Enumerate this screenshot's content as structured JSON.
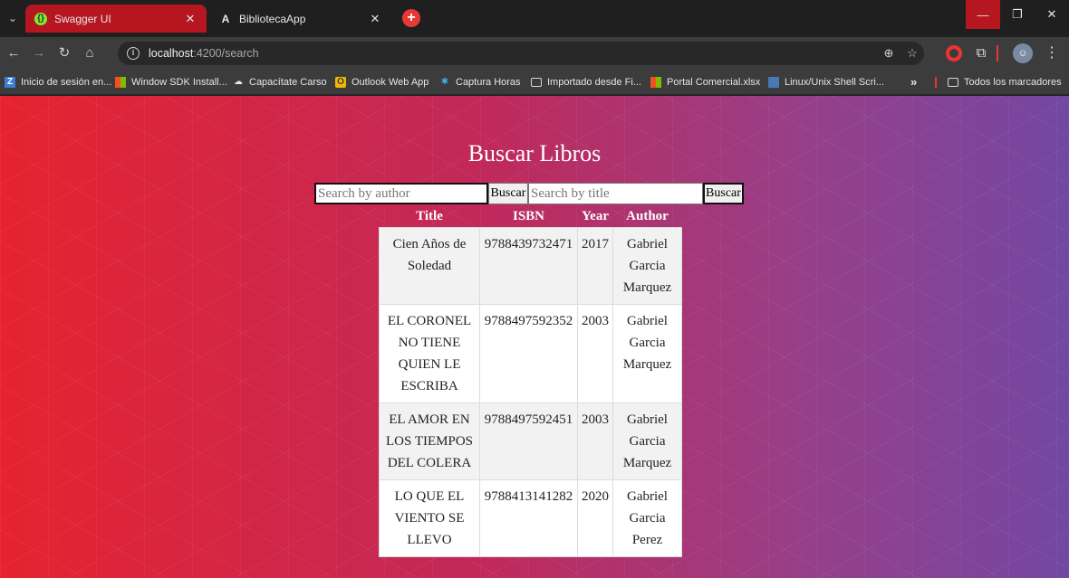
{
  "browser": {
    "tabs": [
      {
        "title": "Swagger UI",
        "active": true
      },
      {
        "title": "BibliotecaApp",
        "active": false
      }
    ],
    "url_host": "localhost",
    "url_path": ":4200/search",
    "bookmarks": [
      {
        "label": "Inicio de sesión en...",
        "icon": "z-icon"
      },
      {
        "label": "Window SDK Install...",
        "icon": "windows-icon"
      },
      {
        "label": "Capacítate Carso",
        "icon": "cloud-icon"
      },
      {
        "label": "Outlook Web App",
        "icon": "outlook-icon"
      },
      {
        "label": "Captura Horas",
        "icon": "spinner-icon"
      },
      {
        "label": "Importado desde Fi...",
        "icon": "folder-icon"
      },
      {
        "label": "Portal Comercial.xlsx",
        "icon": "windows-icon"
      },
      {
        "label": "Linux/Unix Shell Scri...",
        "icon": "linux-icon"
      }
    ],
    "bookmarks_overflow": "»",
    "all_bookmarks": "Todos los marcadores"
  },
  "page": {
    "title": "Buscar Libros",
    "author_search_placeholder": "Search by author",
    "author_search_button": "Buscar",
    "title_search_placeholder": "Search by title",
    "title_search_button": "Buscar",
    "table": {
      "headers": [
        "Title",
        "ISBN",
        "Year",
        "Author"
      ],
      "rows": [
        {
          "title": "Cien Años de Soledad",
          "isbn": "9788439732471",
          "year": "2017",
          "author": "Gabriel Garcia Marquez"
        },
        {
          "title": "EL CORONEL NO TIENE QUIEN LE ESCRIBA",
          "isbn": "9788497592352",
          "year": "2003",
          "author": "Gabriel Garcia Marquez"
        },
        {
          "title": "EL AMOR EN LOS TIEMPOS DEL COLERA",
          "isbn": "9788497592451",
          "year": "2003",
          "author": "Gabriel Garcia Marquez"
        },
        {
          "title": "LO QUE EL VIENTO SE LLEVO",
          "isbn": "9788413141282",
          "year": "2020",
          "author": "Gabriel Garcia Perez"
        }
      ]
    }
  },
  "colors": {
    "gradient_start": "#e6232f",
    "gradient_end": "#7347a3",
    "active_tab": "#b5161f"
  }
}
